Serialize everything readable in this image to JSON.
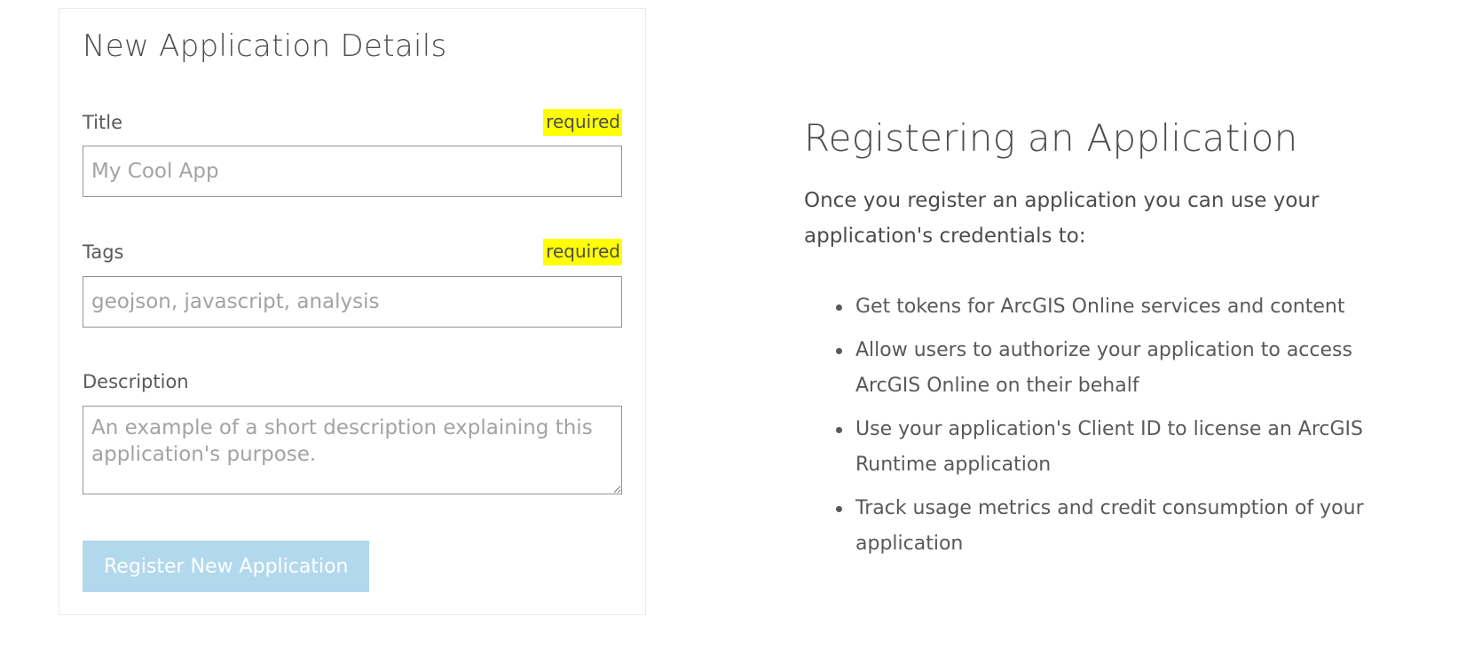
{
  "form": {
    "title": "New Application Details",
    "title_field": {
      "label": "Title",
      "required_label": "required",
      "placeholder": "My Cool App",
      "value": ""
    },
    "tags_field": {
      "label": "Tags",
      "required_label": "required",
      "placeholder": "geojson, javascript, analysis",
      "value": ""
    },
    "description_field": {
      "label": "Description",
      "placeholder": "An example of a short description explaining this application's purpose.",
      "value": ""
    },
    "submit_label": "Register New Application",
    "submit_enabled": false
  },
  "info": {
    "title": "Registering an Application",
    "intro": "Once you register an application you can use your application's credentials to:",
    "items": [
      "Get tokens for ArcGIS Online services and content",
      "Allow users to authorize your application to access ArcGIS Online on their behalf",
      "Use your application's Client ID to license an ArcGIS Runtime application",
      "Track usage metrics and credit consumption of your application"
    ]
  },
  "colors": {
    "required_highlight": "#ffff00",
    "button_disabled": "#b2d8ed",
    "text": "#4c4c4c",
    "input_border": "#959595"
  }
}
